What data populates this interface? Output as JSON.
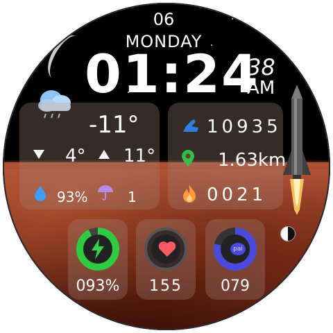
{
  "date": {
    "day_number": "06",
    "day_name": "MONDAY"
  },
  "time": {
    "hours_minutes": "01:24",
    "seconds": "38",
    "ampm": "AM"
  },
  "weather": {
    "icon": "cloud-rain-icon",
    "current_temp": "-11°",
    "low_temp": "4°",
    "high_temp": "11°",
    "humidity": "93%",
    "uv_index": "1"
  },
  "activity": {
    "steps": "10935",
    "distance": "1.63km",
    "calories": "0021"
  },
  "complications": [
    {
      "name": "battery",
      "icon": "lightning-icon",
      "value": "093%",
      "level": 0.93,
      "ring_color": "#2ecc40"
    },
    {
      "name": "heart-rate",
      "icon": "heart-icon",
      "value": "155",
      "level": 0.0,
      "ring_color": "#e74c4c"
    },
    {
      "name": "pai",
      "icon": "pai-icon",
      "icon_text": "pai",
      "value": "079",
      "level": 0.79,
      "ring_color": "#4a4adf"
    }
  ],
  "colors": {
    "step_icon": "#2f7fe0",
    "location_icon": "#2fbf4a",
    "fire_icon": "#ff9a3c",
    "drop_icon": "#3aa0ff",
    "umbrella_icon": "#b88ae6"
  }
}
